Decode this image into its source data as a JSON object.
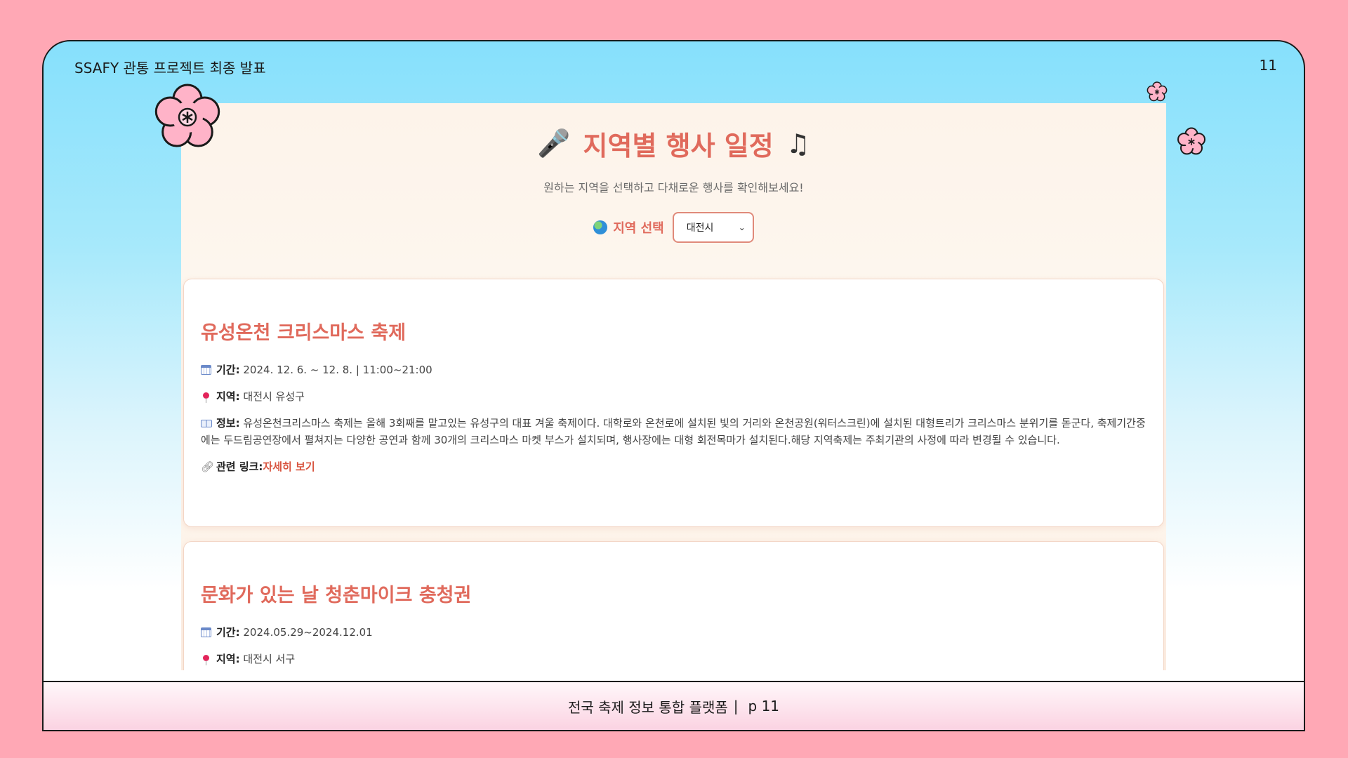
{
  "slide": {
    "title": "SSAFY 관통 프로젝트 최종 발표",
    "number": "11",
    "footer_text": "전국 축제 정보 통합 플랫폼",
    "footer_sep": "|",
    "footer_page": "p 11"
  },
  "page": {
    "heading": "지역별 행사 일정",
    "heading_icon_left": "🎤",
    "heading_icon_right": "♫",
    "subtitle": "원하는 지역을 선택하고 다채로운 행사를 확인해보세요!",
    "region_label": "지역 선택",
    "region_selected": "대전시"
  },
  "events": [
    {
      "title": "유성온천 크리스마스 축제",
      "period_label": "기간:",
      "period": "2024. 12. 6. ~ 12. 8. | 11:00~21:00",
      "region_label": "지역:",
      "region": "대전시 유성구",
      "info_label": "정보:",
      "info": "유성온천크리스마스 축제는 올해 3회째를 맡고있는 유성구의 대표 겨울 축제이다. 대학로와 온천로에 설치된 빛의 거리와 온천공원(워터스크린)에 설치된 대형트리가 크리스마스 분위기를 돋군다, 축제기간중에는 두드림공연장에서 펼쳐지는 다양한 공연과 함께 30개의 크리스마스 마켓 부스가 설치되며, 행사장에는 대형 회전목마가 설치된다.해당 지역축제는 주최기관의 사정에 따라 변경될 수 있습니다.",
      "link_label": "관련 링크:",
      "link_text": "자세히 보기"
    },
    {
      "title": "문화가 있는 날 청춘마이크 충청권",
      "period_label": "기간:",
      "period": "2024.05.29~2024.12.01",
      "region_label": "지역:",
      "region": "대전시 서구"
    }
  ],
  "colors": {
    "background": "#ffa8b5",
    "accent": "#e06a5c",
    "link": "#d8543f",
    "flower_fill": "#ffb3c8"
  },
  "icons": [
    "microphone-icon",
    "music-note-icon",
    "globe-icon",
    "calendar-icon",
    "pin-icon",
    "book-icon",
    "link-icon",
    "chevron-down-icon",
    "flower-icon"
  ]
}
